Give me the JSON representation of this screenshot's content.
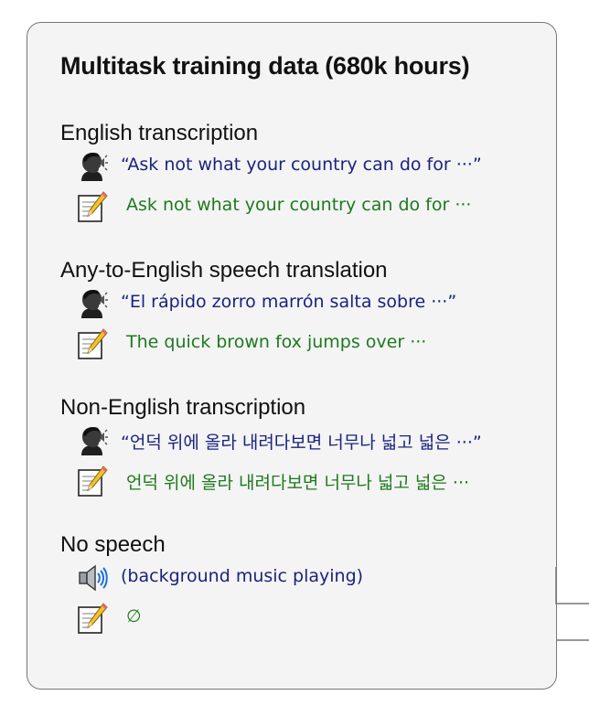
{
  "colors": {
    "panel_bg": "#f4f4f4",
    "panel_border": "#767676",
    "input_text": "#1a237e",
    "output_text": "#1e7a1e"
  },
  "title": "Multitask training data (680k hours)",
  "sections": [
    {
      "title": "English transcription",
      "input_icon": "speaking-head-icon",
      "input_text": "“Ask not what your country can do for ···”",
      "output_icon": "memo-icon",
      "output_text": "Ask not what your country can do for ···"
    },
    {
      "title": "Any-to-English speech translation",
      "input_icon": "speaking-head-icon",
      "input_text": "“El rápido zorro marrón salta sobre ···”",
      "output_icon": "memo-icon",
      "output_text": "The quick brown fox jumps over ···"
    },
    {
      "title": "Non-English transcription",
      "input_icon": "speaking-head-icon",
      "input_text": "“언덕 위에 올라 내려다보면 너무나 넓고 넓은 ···”",
      "output_icon": "memo-icon",
      "output_text": "언덕 위에 올라 내려다보면 너무나 넓고 넓은 ···"
    },
    {
      "title": "No speech",
      "input_icon": "speaker-icon",
      "input_text": "(background music playing)",
      "output_icon": "memo-icon",
      "output_text": "∅"
    }
  ]
}
